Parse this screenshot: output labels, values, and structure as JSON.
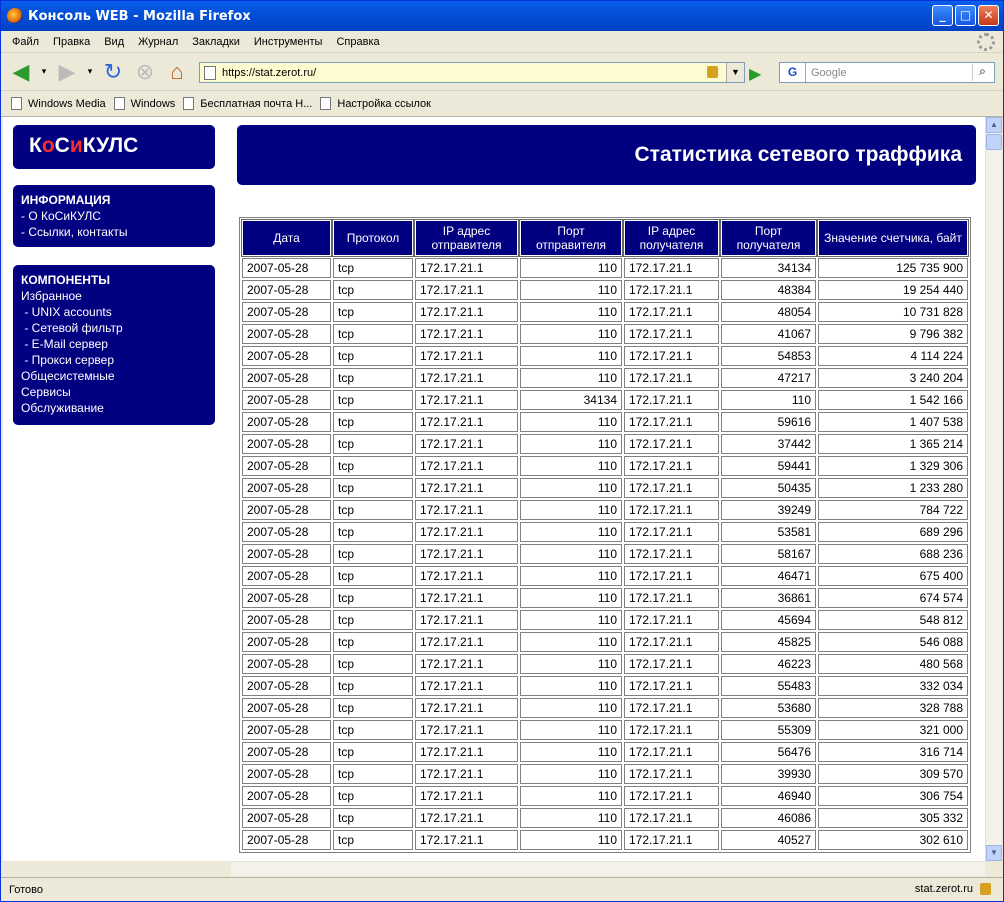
{
  "window": {
    "title": "Консоль WEB - Mozilla Firefox"
  },
  "menu": [
    "Файл",
    "Правка",
    "Вид",
    "Журнал",
    "Закладки",
    "Инструменты",
    "Справка"
  ],
  "address": {
    "url": "https://stat.zerot.ru/"
  },
  "search": {
    "placeholder": "Google"
  },
  "bookmarks": [
    "Windows Media",
    "Windows",
    "Бесплатная почта Н...",
    "Настройка ссылок"
  ],
  "status": {
    "text": "Готово",
    "host": "stat.zerot.ru"
  },
  "sidebar": {
    "logo": {
      "p1": "К",
      "p2": "о",
      "p3": "С",
      "p4": "и",
      "p5": "КУЛС"
    },
    "info": {
      "title": "ИНФОРМАЦИЯ",
      "links": [
        "- О КоСиКУЛС",
        "- Ссылки, контакты"
      ]
    },
    "components": {
      "title": "КОМПОНЕНТЫ",
      "links": [
        "Избранное",
        " - UNIX accounts",
        " - Сетевой фильтр",
        " - E-Mail сервер",
        " - Прокси сервер",
        "Общесистемные",
        "Сервисы",
        "Обслуживание"
      ]
    }
  },
  "page": {
    "title": "Статистика сетевого траффика"
  },
  "table": {
    "headers": [
      "Дата",
      "Протокол",
      "IP адрес отправителя",
      "Порт отправителя",
      "IP адрес получателя",
      "Порт получателя",
      "Значение счетчика, байт"
    ],
    "rows": [
      [
        "2007-05-28",
        "tcp",
        "172.17.21.1",
        "110",
        "172.17.21.1",
        "34134",
        "125 735 900"
      ],
      [
        "2007-05-28",
        "tcp",
        "172.17.21.1",
        "110",
        "172.17.21.1",
        "48384",
        "19 254 440"
      ],
      [
        "2007-05-28",
        "tcp",
        "172.17.21.1",
        "110",
        "172.17.21.1",
        "48054",
        "10 731 828"
      ],
      [
        "2007-05-28",
        "tcp",
        "172.17.21.1",
        "110",
        "172.17.21.1",
        "41067",
        "9 796 382"
      ],
      [
        "2007-05-28",
        "tcp",
        "172.17.21.1",
        "110",
        "172.17.21.1",
        "54853",
        "4 114 224"
      ],
      [
        "2007-05-28",
        "tcp",
        "172.17.21.1",
        "110",
        "172.17.21.1",
        "47217",
        "3 240 204"
      ],
      [
        "2007-05-28",
        "tcp",
        "172.17.21.1",
        "34134",
        "172.17.21.1",
        "110",
        "1 542 166"
      ],
      [
        "2007-05-28",
        "tcp",
        "172.17.21.1",
        "110",
        "172.17.21.1",
        "59616",
        "1 407 538"
      ],
      [
        "2007-05-28",
        "tcp",
        "172.17.21.1",
        "110",
        "172.17.21.1",
        "37442",
        "1 365 214"
      ],
      [
        "2007-05-28",
        "tcp",
        "172.17.21.1",
        "110",
        "172.17.21.1",
        "59441",
        "1 329 306"
      ],
      [
        "2007-05-28",
        "tcp",
        "172.17.21.1",
        "110",
        "172.17.21.1",
        "50435",
        "1 233 280"
      ],
      [
        "2007-05-28",
        "tcp",
        "172.17.21.1",
        "110",
        "172.17.21.1",
        "39249",
        "784 722"
      ],
      [
        "2007-05-28",
        "tcp",
        "172.17.21.1",
        "110",
        "172.17.21.1",
        "53581",
        "689 296"
      ],
      [
        "2007-05-28",
        "tcp",
        "172.17.21.1",
        "110",
        "172.17.21.1",
        "58167",
        "688 236"
      ],
      [
        "2007-05-28",
        "tcp",
        "172.17.21.1",
        "110",
        "172.17.21.1",
        "46471",
        "675 400"
      ],
      [
        "2007-05-28",
        "tcp",
        "172.17.21.1",
        "110",
        "172.17.21.1",
        "36861",
        "674 574"
      ],
      [
        "2007-05-28",
        "tcp",
        "172.17.21.1",
        "110",
        "172.17.21.1",
        "45694",
        "548 812"
      ],
      [
        "2007-05-28",
        "tcp",
        "172.17.21.1",
        "110",
        "172.17.21.1",
        "45825",
        "546 088"
      ],
      [
        "2007-05-28",
        "tcp",
        "172.17.21.1",
        "110",
        "172.17.21.1",
        "46223",
        "480 568"
      ],
      [
        "2007-05-28",
        "tcp",
        "172.17.21.1",
        "110",
        "172.17.21.1",
        "55483",
        "332 034"
      ],
      [
        "2007-05-28",
        "tcp",
        "172.17.21.1",
        "110",
        "172.17.21.1",
        "53680",
        "328 788"
      ],
      [
        "2007-05-28",
        "tcp",
        "172.17.21.1",
        "110",
        "172.17.21.1",
        "55309",
        "321 000"
      ],
      [
        "2007-05-28",
        "tcp",
        "172.17.21.1",
        "110",
        "172.17.21.1",
        "56476",
        "316 714"
      ],
      [
        "2007-05-28",
        "tcp",
        "172.17.21.1",
        "110",
        "172.17.21.1",
        "39930",
        "309 570"
      ],
      [
        "2007-05-28",
        "tcp",
        "172.17.21.1",
        "110",
        "172.17.21.1",
        "46940",
        "306 754"
      ],
      [
        "2007-05-28",
        "tcp",
        "172.17.21.1",
        "110",
        "172.17.21.1",
        "46086",
        "305 332"
      ],
      [
        "2007-05-28",
        "tcp",
        "172.17.21.1",
        "110",
        "172.17.21.1",
        "40527",
        "302 610"
      ]
    ]
  }
}
